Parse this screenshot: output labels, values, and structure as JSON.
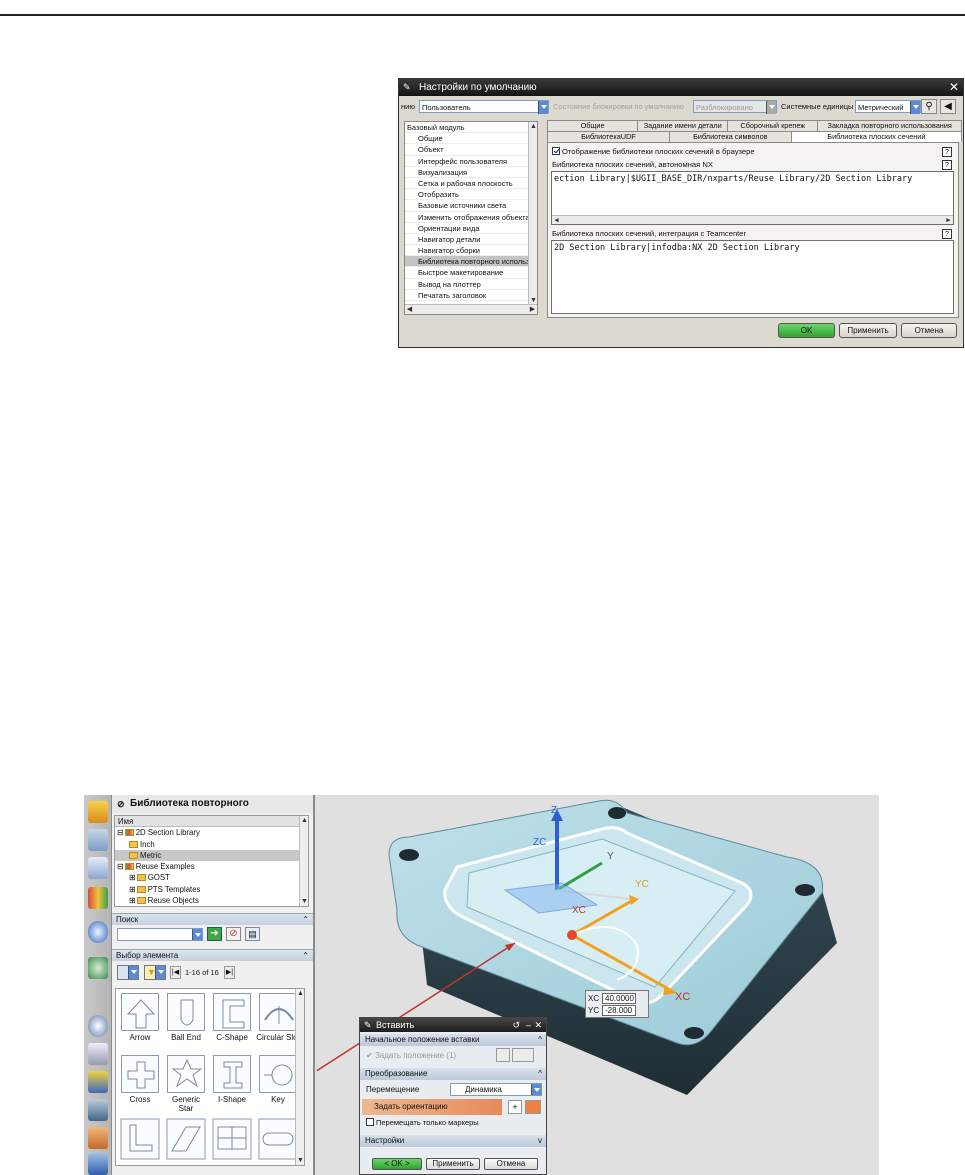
{
  "defaults_dialog": {
    "title": "Настройки по умолчанию",
    "level_label": "нию",
    "level_value": "Пользователь",
    "lock_label": "Состояние блокировки по умолчанию",
    "lock_value": "Разблокировано",
    "units_label": "Системные единицы",
    "units_value": "Метрический",
    "tree_items": [
      "Базовый модуль",
      "Общие",
      "Объект",
      "Интерфейс пользователя",
      "Визуализация",
      "Сетка и рабочая плоскость",
      "Отобразить",
      "Базовые источники света",
      "Изменить отображения объекта",
      "Ориентации вида",
      "Навигатор детали",
      "Навигатор сборки",
      "Библиотека повторного использов",
      "Быстрое макетирование",
      "Вывод на плоттер",
      "Печатать заголовок"
    ],
    "tabs_row1": [
      "Общие",
      "Задание имени детали",
      "Сборочный крепеж",
      "Закладка повторного использования"
    ],
    "tabs_row2": [
      "БиблиотекаUDF",
      "Библиотека символов",
      "Библиотека плоских сечений"
    ],
    "checkbox_label": "Отображение библиотеки плоских сечений в браузере",
    "native_label": "Библиотека плоских сечений, автономная NX",
    "native_value": "ection Library|$UGII_BASE_DIR/nxparts/Reuse Library/2D Section Library",
    "tc_label": "Библиотека плоских сечений, интеграция с Teamcenter",
    "tc_value": "2D Section Library|infodba:NX 2D Section Library",
    "btn_ok": "OK",
    "btn_apply": "Применить",
    "btn_cancel": "Отмена"
  },
  "reuse_panel": {
    "title": "Библиотека повторного использов...",
    "col_name": "Имя",
    "tree": [
      {
        "label": "2D Section Library",
        "indent": 0,
        "exp": "⊟"
      },
      {
        "label": "Inch",
        "indent": 1,
        "exp": ""
      },
      {
        "label": "Metric",
        "indent": 1,
        "exp": ""
      },
      {
        "label": "Reuse Examples",
        "indent": 0,
        "exp": "⊟"
      },
      {
        "label": "GOST",
        "indent": 1,
        "exp": "⊞"
      },
      {
        "label": "PTS Templates",
        "indent": 1,
        "exp": "⊞"
      },
      {
        "label": "Reuse Objects",
        "indent": 1,
        "exp": "⊞"
      }
    ],
    "search_title": "Поиск",
    "select_title": "Выбор элемента",
    "page_range": "1-16 of 16",
    "items": [
      "Arrow",
      "Ball End",
      "C-Shape",
      "Circular Slot",
      "Cross",
      "Generic Star",
      "I-Shape",
      "Key"
    ]
  },
  "insert_dialog": {
    "title": "Вставить",
    "group1": "Начальное положение вставки",
    "set_position": "Задать положение (1)",
    "group2": "Преобразование",
    "move_label": "Перемещение",
    "move_value": "Динамика",
    "set_orientation": "Задать ориентацию",
    "markers_only": "Перемещать только маркеры",
    "group3": "Настройки",
    "btn_ok": "< OK >",
    "btn_apply": "Применить",
    "btn_cancel": "Отмена"
  },
  "viewport": {
    "xc_label": "XC",
    "yc_label": "YC",
    "xc_value": "40.0000",
    "yc_value": "-28.000",
    "axis_z": "Z",
    "axis_zc": "ZC",
    "axis_y": "Y",
    "axis_yc": "YC",
    "axis_xc1": "XC",
    "axis_xc2": "XC"
  }
}
